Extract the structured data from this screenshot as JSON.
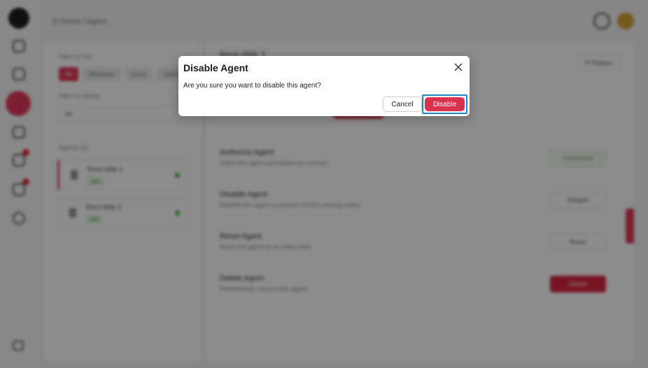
{
  "app": {
    "breadcrumb": "⊡ Home / Agent",
    "filter": {
      "os_label": "Filter by OS",
      "os_tabs": [
        "All",
        "Windows",
        "Linux",
        "macOS"
      ],
      "status_label": "Filter by status",
      "status_value": "All",
      "agents_label": "Agents (2)",
      "agents": [
        {
          "name": "linux-ship 1",
          "status": "Idle"
        },
        {
          "name": "linux-ship 2",
          "status": "Idle"
        }
      ]
    },
    "content": {
      "title": "linux-ship 1",
      "reboot_label": "⟳ Reboot",
      "actions": [
        {
          "title": "Authorize Agent",
          "desc": "Grant this agent permission to connect.",
          "button": "Authorized"
        },
        {
          "title": "Disable Agent",
          "desc": "Disable this agent to prevent it from running works.",
          "button": "Disable"
        },
        {
          "title": "Reset Agent",
          "desc": "Reset the agent to its initial state.",
          "button": "Reset"
        },
        {
          "title": "Delete Agent",
          "desc": "Permanently remove this agent.",
          "button": "Delete"
        }
      ]
    }
  },
  "modal": {
    "title": "Disable Agent",
    "message": "Are you sure you want to disable this agent?",
    "cancel_label": "Cancel",
    "confirm_label": "Disable"
  },
  "colors": {
    "accent": "#d9324f",
    "focus_ring": "#1f86d6",
    "overlay": "rgba(0,0,0,0.45)"
  }
}
